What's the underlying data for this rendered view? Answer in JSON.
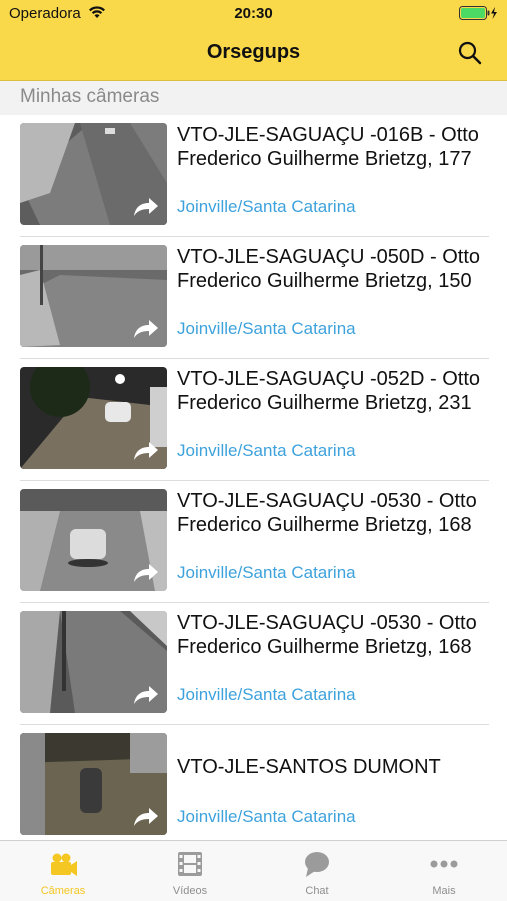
{
  "status_bar": {
    "carrier": "Operadora",
    "time": "20:30"
  },
  "nav": {
    "title": "Orsegups",
    "search_icon": "search-icon"
  },
  "section": {
    "title": "Minhas câmeras"
  },
  "cameras": [
    {
      "name": "VTO-JLE-SAGUAÇU -016B - Otto Frederico Guilherme Brietzg, 177",
      "location": "Joinville/Santa Catarina"
    },
    {
      "name": "VTO-JLE-SAGUAÇU -050D - Otto Frederico Guilherme Brietzg, 150",
      "location": "Joinville/Santa Catarina"
    },
    {
      "name": "VTO-JLE-SAGUAÇU -052D - Otto Frederico Guilherme Brietzg, 231",
      "location": "Joinville/Santa Catarina"
    },
    {
      "name": "VTO-JLE-SAGUAÇU -0530 - Otto Frederico Guilherme Brietzg, 168",
      "location": "Joinville/Santa Catarina"
    },
    {
      "name": "VTO-JLE-SAGUAÇU -0530 - Otto Frederico Guilherme Brietzg, 168",
      "location": "Joinville/Santa Catarina"
    },
    {
      "name": "VTO-JLE-SANTOS DUMONT",
      "location": "Joinville/Santa Catarina"
    }
  ],
  "tabs": [
    {
      "label": "Câmeras",
      "icon": "camera-icon",
      "active": true
    },
    {
      "label": "Vídeos",
      "icon": "film-icon",
      "active": false
    },
    {
      "label": "Chat",
      "icon": "chat-bubble-icon",
      "active": false
    },
    {
      "label": "Mais",
      "icon": "more-dots-icon",
      "active": false
    }
  ],
  "colors": {
    "accent": "#f9d84a",
    "tab_active": "#f4c722",
    "link": "#3ea2dc"
  }
}
